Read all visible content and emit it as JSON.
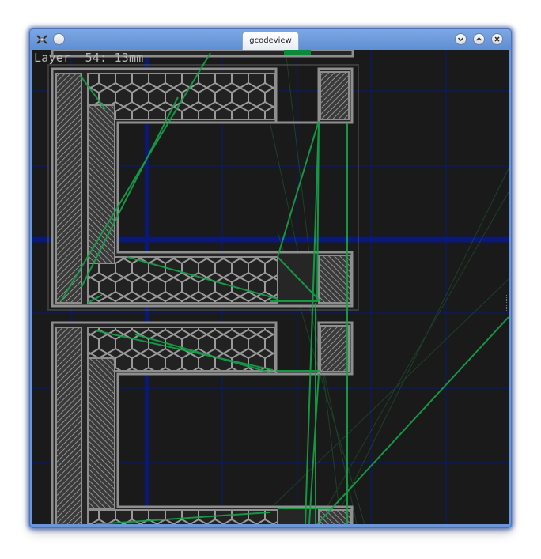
{
  "window": {
    "title": "gcodeview",
    "accent_color": "#5f8ed3",
    "controls": {
      "minimize_icon": "chevron-down-icon",
      "maximize_icon": "chevron-up-icon",
      "close_icon": "close-icon"
    },
    "menu_icon": "circle-dot-icon",
    "app_icon": "gcodeview-app-icon"
  },
  "viewer": {
    "layer_label": "Layer  54: 13mm",
    "colors": {
      "background": "#1a1a1a",
      "grid": "#0b1a66",
      "axis": "#0a1878",
      "extrusion": "#8e8e8e",
      "travel": "#16a34a"
    }
  }
}
